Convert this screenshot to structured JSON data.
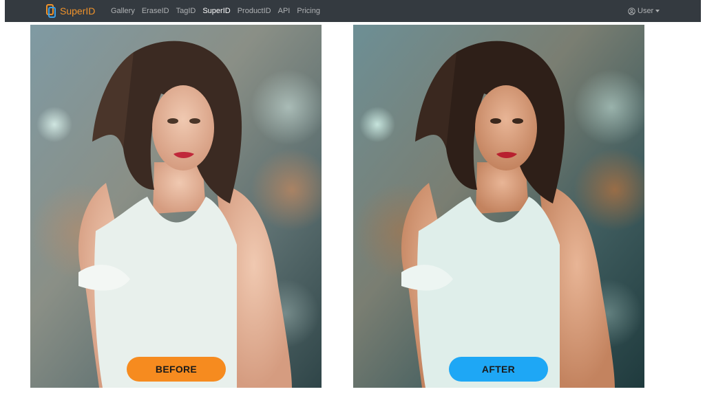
{
  "navbar": {
    "brand": "SuperID",
    "links": [
      {
        "label": "Gallery"
      },
      {
        "label": "EraseID"
      },
      {
        "label": "TagID"
      },
      {
        "label": "SuperID",
        "active": true
      },
      {
        "label": "ProductID"
      },
      {
        "label": "API"
      },
      {
        "label": "Pricing"
      }
    ],
    "user_label": "User"
  },
  "comparison": {
    "before_label": "BEFORE",
    "after_label": "AFTER"
  },
  "colors": {
    "navbar_bg": "#343a40",
    "brand_accent": "#f0932b",
    "before_pill": "#f68b1f",
    "after_pill": "#1ea7f5"
  },
  "icons": {
    "brand": "superid-logo-icon",
    "user": "user-circle-icon",
    "caret": "caret-down-icon"
  }
}
